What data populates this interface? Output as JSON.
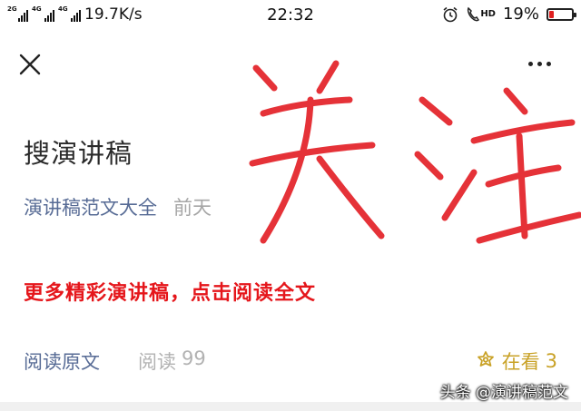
{
  "status_bar": {
    "sim1_label": "2G",
    "sim2_label": "4G",
    "sim3_label": "4G",
    "network_speed": "19.7K/s",
    "time": "22:32",
    "hd_label": "HD",
    "battery_percent": "19%",
    "battery_level": 0.19
  },
  "article": {
    "title": "搜演讲稿",
    "account_name": "演讲稿范文大全",
    "date": "前天",
    "promo_text": "更多精彩演讲稿，点击阅读全文"
  },
  "footer": {
    "read_original": "阅读原文",
    "read_label": "阅读",
    "read_count": "99",
    "watching_label": "在看",
    "watching_count": "3"
  },
  "watermark": "头条 @演讲稿范文",
  "colors": {
    "link": "#576b95",
    "promo": "#e5161b",
    "watching": "#c9a227",
    "handwriting": "#e53238"
  }
}
